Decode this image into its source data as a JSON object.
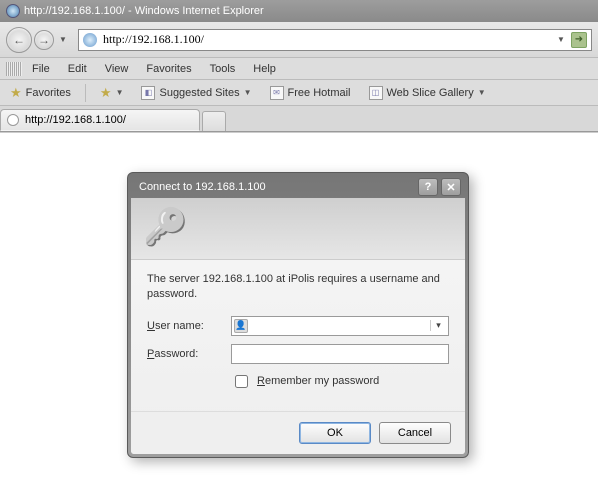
{
  "window": {
    "title": "http://192.168.1.100/ - Windows Internet Explorer"
  },
  "address_bar": {
    "value": "http://192.168.1.100/"
  },
  "menu": {
    "file": "File",
    "edit": "Edit",
    "view": "View",
    "favorites": "Favorites",
    "tools": "Tools",
    "help": "Help"
  },
  "favorites_bar": {
    "favorites": "Favorites",
    "suggested": "Suggested Sites",
    "hotmail": "Free Hotmail",
    "slice": "Web Slice Gallery"
  },
  "tab": {
    "title": "http://192.168.1.100/"
  },
  "dialog": {
    "title": "Connect to 192.168.1.100",
    "message": "The server 192.168.1.100 at iPolis requires a username and password.",
    "username_label": "User name:",
    "password_label": "Password:",
    "username_value": "",
    "password_value": "",
    "remember": "Remember my password",
    "ok": "OK",
    "cancel": "Cancel"
  }
}
